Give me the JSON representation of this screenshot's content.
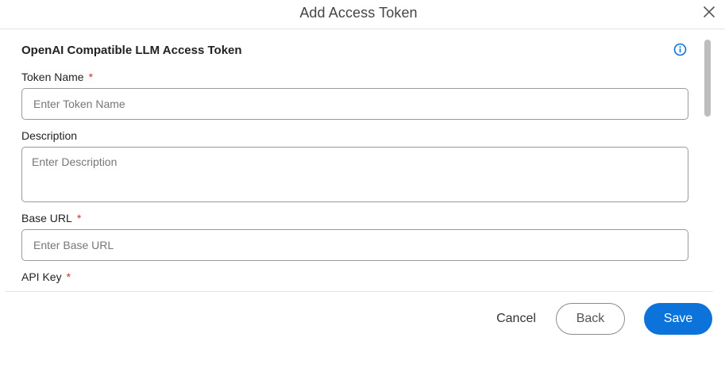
{
  "dialog": {
    "title": "Add Access Token"
  },
  "form": {
    "section_title": "OpenAI Compatible LLM Access Token",
    "required_marker": "*",
    "fields": {
      "token_name": {
        "label": "Token Name",
        "placeholder": "Enter Token Name",
        "value": ""
      },
      "description": {
        "label": "Description",
        "placeholder": "Enter Description",
        "value": ""
      },
      "base_url": {
        "label": "Base URL",
        "placeholder": "Enter Base URL",
        "value": ""
      },
      "api_key": {
        "label": "API Key"
      }
    }
  },
  "footer": {
    "cancel_label": "Cancel",
    "back_label": "Back",
    "save_label": "Save"
  },
  "colors": {
    "accent": "#0b73d9",
    "required": "#d32f2f",
    "border": "#9a9a9a"
  },
  "icons": {
    "close": "close-icon",
    "info": "info-icon"
  }
}
